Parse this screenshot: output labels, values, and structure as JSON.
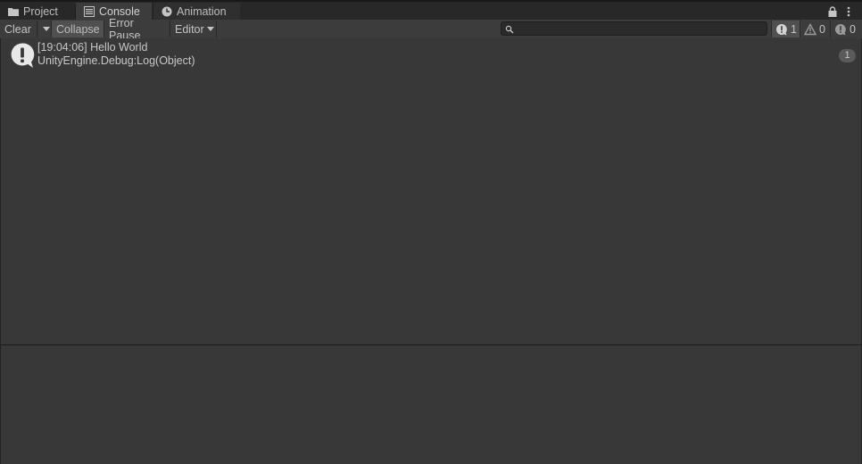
{
  "tabs": {
    "project": "Project",
    "console": "Console",
    "animation": "Animation"
  },
  "toolbar": {
    "clear": "Clear",
    "collapse": "Collapse",
    "error_pause": "Error Pause",
    "editor": "Editor",
    "search_value": "",
    "counts": {
      "errors": "1",
      "warnings": "0",
      "info": "0"
    }
  },
  "log": [
    {
      "line1": "[19:04:06] Hello World",
      "line2": "UnityEngine.Debug:Log(Object)",
      "count": "1",
      "icon": "info-message-icon"
    }
  ],
  "colors": {
    "panel_bg": "#383838",
    "toolbar_bg": "#3c3c3c",
    "tab_bar_bg": "#282828",
    "pressed_bg": "#505050",
    "text": "#c4c4c4"
  }
}
